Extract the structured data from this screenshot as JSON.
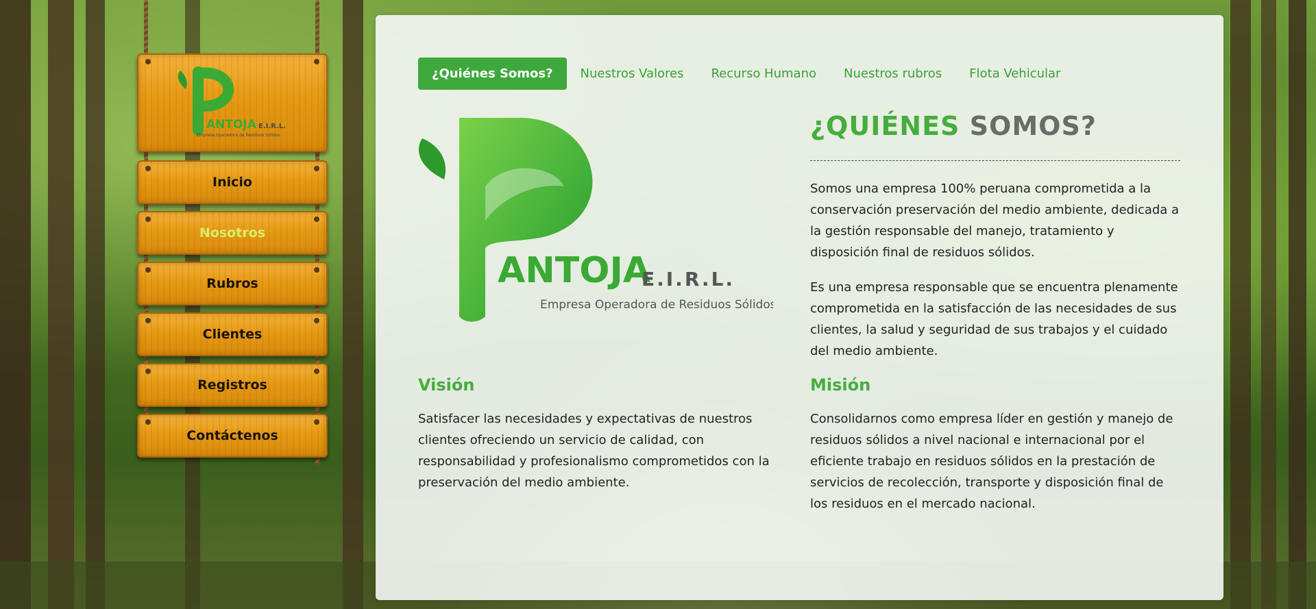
{
  "colors": {
    "brand_green": "#46ad3e",
    "tab_active_bg": "#3ea83c",
    "title_grey": "#6b6b6b",
    "wood": "#e69a14",
    "nav_active": "#d8ef6a"
  },
  "logo": {
    "brand": "ANTOJA",
    "suffix": "E.I.R.L.",
    "tagline": "Empresa Operadora de Residuos Sólidos"
  },
  "side_nav": {
    "items": [
      {
        "label": "Inicio",
        "active": false
      },
      {
        "label": "Nosotros",
        "active": true
      },
      {
        "label": "Rubros",
        "active": false
      },
      {
        "label": "Clientes",
        "active": false
      },
      {
        "label": "Registros",
        "active": false
      },
      {
        "label": "Contáctenos",
        "active": false
      }
    ]
  },
  "tabs": [
    {
      "label": "¿Quiénes Somos?",
      "active": true
    },
    {
      "label": "Nuestros Valores",
      "active": false
    },
    {
      "label": "Recurso Humano",
      "active": false
    },
    {
      "label": "Nuestros rubros",
      "active": false
    },
    {
      "label": "Flota Vehicular",
      "active": false
    }
  ],
  "about": {
    "title_part1": "¿QUIÉNES",
    "title_part2": "SOMOS?",
    "paragraph1": "Somos una empresa 100% peruana comprometida a la conservación preservación del medio ambiente, dedicada a la gestión responsable del manejo, tratamiento y disposición final de residuos sólidos.",
    "paragraph2": "Es una empresa responsable que se encuentra plenamente comprometida en la satisfacción de las necesidades de sus clientes, la salud y seguridad de sus trabajos y el cuidado del medio ambiente."
  },
  "vision": {
    "heading": "Visión",
    "text": "Satisfacer las necesidades y expectativas de nuestros clientes ofreciendo un servicio de calidad, con responsabilidad y profesionalismo comprometidos con la preservación del medio ambiente."
  },
  "mission": {
    "heading": "Misión",
    "text": "Consolidarnos como empresa líder en gestión y manejo de residuos sólidos a nivel nacional e internacional por el eficiente trabajo en residuos sólidos en la prestación de servicios de recolección, transporte y disposición final de los residuos en el mercado nacional."
  }
}
